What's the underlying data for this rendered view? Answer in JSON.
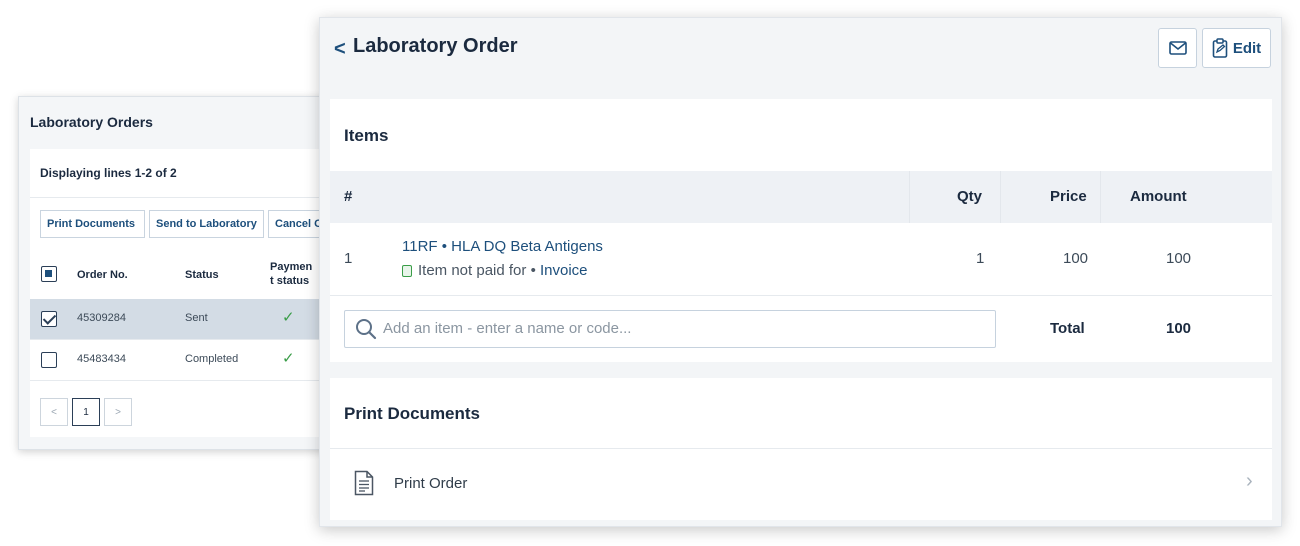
{
  "back_panel": {
    "title": "Laboratory Orders",
    "lines_info": "Displaying lines 1-2 of 2",
    "buttons": [
      "Print Documents",
      "Send to Laboratory",
      "Cancel O"
    ],
    "columns": [
      "Order No.",
      "Status",
      "Paymen",
      "t status"
    ],
    "rows": [
      {
        "order_no": "45309284",
        "status": "Sent",
        "selected": true
      },
      {
        "order_no": "45483434",
        "status": "Completed",
        "selected": false
      }
    ],
    "pagination": {
      "prev": "<",
      "current": "1",
      "next": ">"
    }
  },
  "front_panel": {
    "back_glyph": "<",
    "title": "Laboratory Order",
    "email_icon": "envelope-icon",
    "edit_label": "Edit",
    "items": {
      "title": "Items",
      "columns": {
        "num": "#",
        "qty": "Qty",
        "price": "Price",
        "amount": "Amount"
      },
      "rows": [
        {
          "num": "1",
          "code_name": "11RF • HLA DQ Beta Antigens",
          "payment_status": "Item not paid for",
          "payment_sep": " • ",
          "payment_link": "Invoice",
          "qty": "1",
          "price": "100",
          "amount": "100"
        }
      ],
      "search_placeholder": "Add an item - enter a name or code...",
      "total_label": "Total",
      "total_value": "100"
    },
    "documents": {
      "title": "Print Documents",
      "items": [
        {
          "label": "Print Order",
          "icon": "document-icon"
        }
      ]
    }
  },
  "colors": {
    "accent": "#1d4f7c",
    "check": "#3a9d48",
    "selected_row": "#d3dce5"
  }
}
